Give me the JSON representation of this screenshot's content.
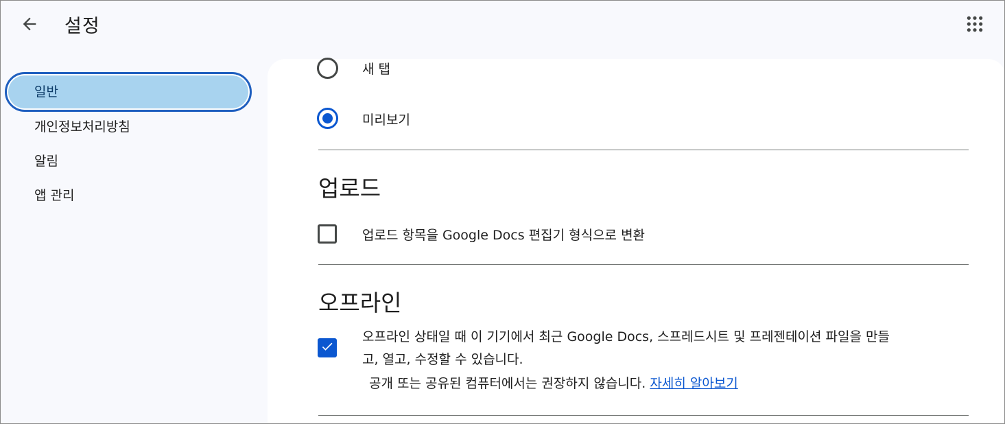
{
  "header": {
    "title": "설정",
    "back_icon": "arrow-left-icon",
    "apps_icon": "apps-grid-icon"
  },
  "sidebar": {
    "items": [
      {
        "label": "일반",
        "active": true
      },
      {
        "label": "개인정보처리방침",
        "active": false
      },
      {
        "label": "알림",
        "active": false
      },
      {
        "label": "앱 관리",
        "active": false
      }
    ]
  },
  "startup": {
    "options": [
      {
        "label": "새 탭",
        "selected": false
      },
      {
        "label": "미리보기",
        "selected": true
      }
    ]
  },
  "upload": {
    "title": "업로드",
    "convert_label": "업로드 항목을 Google Docs 편집기 형식으로 변환",
    "convert_checked": false
  },
  "offline": {
    "title": "오프라인",
    "line1": "오프라인 상태일 때 이 기기에서 최근 Google Docs, 스프레드시트 및 프레젠테이션 파일을 만들",
    "line2": "고, 열고, 수정할 수 있습니다.",
    "warning": "공개 또는 공유된 컴퓨터에서는 권장하지 않습니다.",
    "learn_more": "자세히 알아보기",
    "checked": true
  },
  "colors": {
    "accent": "#0b57d0",
    "active_nav_bg": "#a8d3ef",
    "page_bg": "#f8f9fd"
  }
}
